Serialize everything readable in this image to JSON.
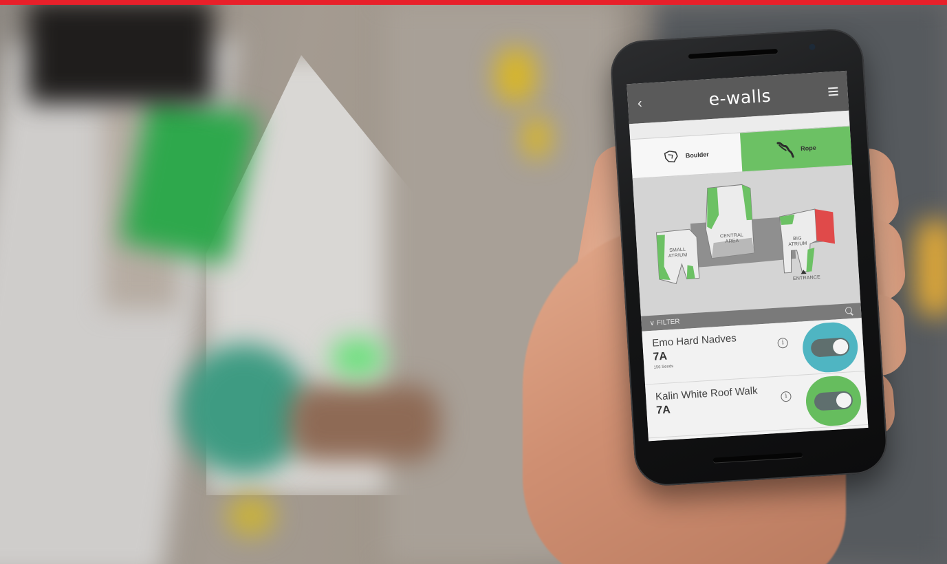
{
  "app": {
    "title": "e-walls",
    "back_icon": "chevron-left-icon",
    "menu_icon": "hamburger-menu-icon"
  },
  "tabs": [
    {
      "label": "Boulder",
      "icon": "boulder-hold-icon",
      "active": false
    },
    {
      "label": "Rope",
      "icon": "rope-icon",
      "active": true
    }
  ],
  "map": {
    "areas": {
      "small_atrium": "SMALL ATRIUM",
      "central_area": "CENTRAL AREA",
      "big_atrium": "BIG ATRIUM"
    },
    "entrance": "ENTRANCE"
  },
  "filter": {
    "label": "FILTER",
    "expand_icon": "chevron-down-icon",
    "search_icon": "search-icon"
  },
  "routes": [
    {
      "name": "Emo Hard Nadves",
      "grade": "7A",
      "sends": "156 Sends",
      "info": "i",
      "enabled": true,
      "accent": "#4fb5c2"
    },
    {
      "name": "Kalin White Roof Walk",
      "grade": "7A",
      "sends": "",
      "info": "i",
      "enabled": true,
      "accent": "#66bd5e"
    }
  ],
  "colors": {
    "brand_bar": "#e8202a",
    "header": "#5a5a5a",
    "rope_green": "#6cc164",
    "map_red": "#e04a4a"
  }
}
